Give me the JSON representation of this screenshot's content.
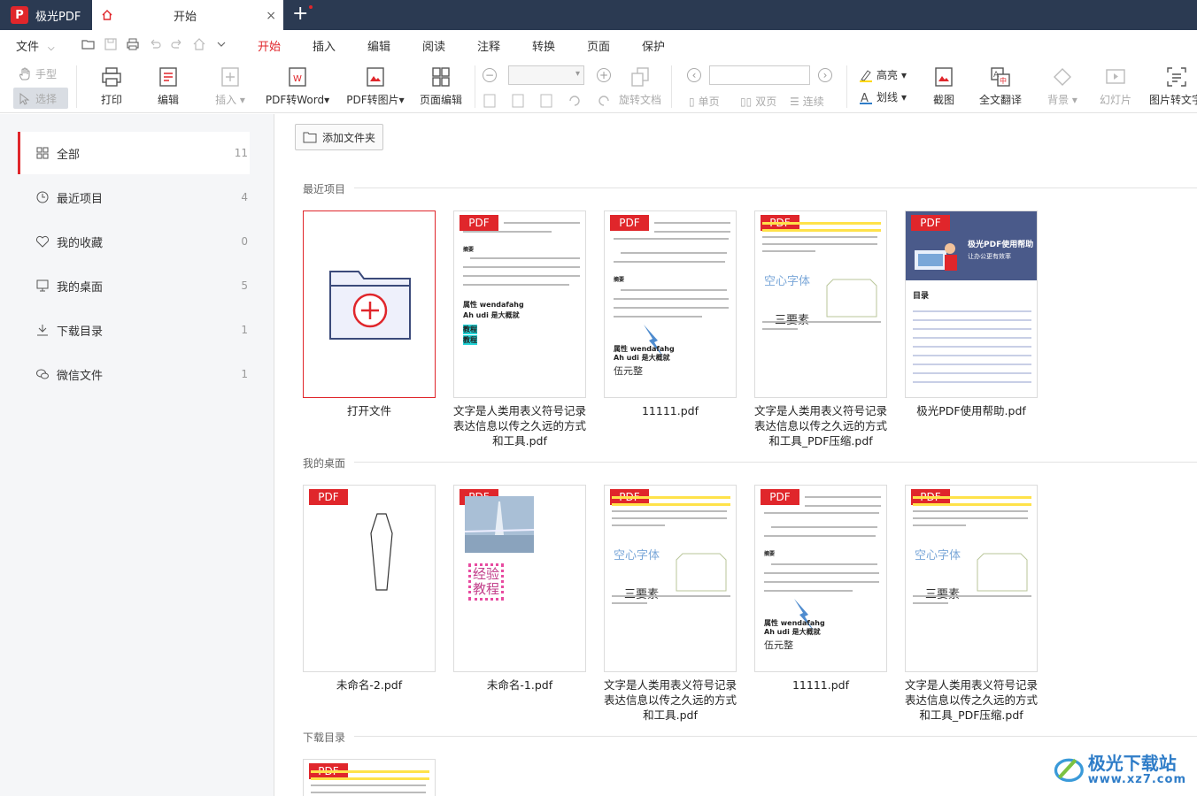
{
  "window": {
    "app_name": "极光PDF",
    "tab_title": "开始",
    "tab_close": "×",
    "new_tab": "+"
  },
  "menu": {
    "file": "文件",
    "tabs": [
      "开始",
      "插入",
      "编辑",
      "阅读",
      "注释",
      "转换",
      "页面",
      "保护"
    ],
    "active_tab": "开始"
  },
  "ribbon": {
    "hand": "手型",
    "select": "选择",
    "print": "打印",
    "edit": "编辑",
    "insert": "插入",
    "pdf_to_word": "PDF转Word",
    "pdf_to_image": "PDF转图片",
    "page_edit": "页面编辑",
    "rotate": "旋转文档",
    "single": "单页",
    "double": "双页",
    "continuous": "连续",
    "highlight": "高亮",
    "strike": "划线",
    "screenshot": "截图",
    "translate": "全文翻译",
    "background": "背景",
    "slideshow": "幻灯片",
    "image_to_text": "图片转文字"
  },
  "sidebar": {
    "items": [
      {
        "label": "全部",
        "count": "11",
        "icon": "grid-icon"
      },
      {
        "label": "最近项目",
        "count": "4",
        "icon": "clock-icon"
      },
      {
        "label": "我的收藏",
        "count": "0",
        "icon": "heart-icon"
      },
      {
        "label": "我的桌面",
        "count": "5",
        "icon": "desktop-icon"
      },
      {
        "label": "下载目录",
        "count": "1",
        "icon": "download-icon"
      },
      {
        "label": "微信文件",
        "count": "1",
        "icon": "wechat-icon"
      }
    ]
  },
  "main": {
    "add_folder": "添加文件夹",
    "pdf_badge": "PDF",
    "sections": [
      {
        "title": "最近项目",
        "files": [
          {
            "name": "打开文件"
          },
          {
            "name": "文字是人类用表义符号记录表达信息以传之久远的方式和工具.pdf"
          },
          {
            "name": "11111.pdf"
          },
          {
            "name": "文字是人类用表义符号记录表达信息以传之久远的方式和工具_PDF压缩.pdf"
          },
          {
            "name": "极光PDF使用帮助.pdf"
          }
        ]
      },
      {
        "title": "我的桌面",
        "files": [
          {
            "name": "未命名-2.pdf"
          },
          {
            "name": "未命名-1.pdf"
          },
          {
            "name": "文字是人类用表义符号记录表达信息以传之久远的方式和工具.pdf"
          },
          {
            "name": "11111.pdf"
          },
          {
            "name": "文字是人类用表义符号记录表达信息以传之久远的方式和工具_PDF压缩.pdf"
          }
        ]
      },
      {
        "title": "下载目录",
        "files": []
      }
    ],
    "thumb_text": {
      "attr": "属性 wendafahg",
      "ah": "Ah udi 是大概就",
      "jiaocheng": "教程",
      "wuyuan": "伍元整",
      "kongxin": "空心字体",
      "sanyaosu": "三要素",
      "help_title": "极光PDF使用帮助",
      "help_sub": "让办公更有效率",
      "help_toc": "目录",
      "jingyan": "经验",
      "jiaocheng2": "教程"
    }
  },
  "watermark": {
    "title": "极光下载站",
    "url": "www.xz7.com"
  },
  "colors": {
    "accent": "#e0262b",
    "titlebar": "#2b3a52",
    "sidebar_bg": "#f5f6f8"
  }
}
